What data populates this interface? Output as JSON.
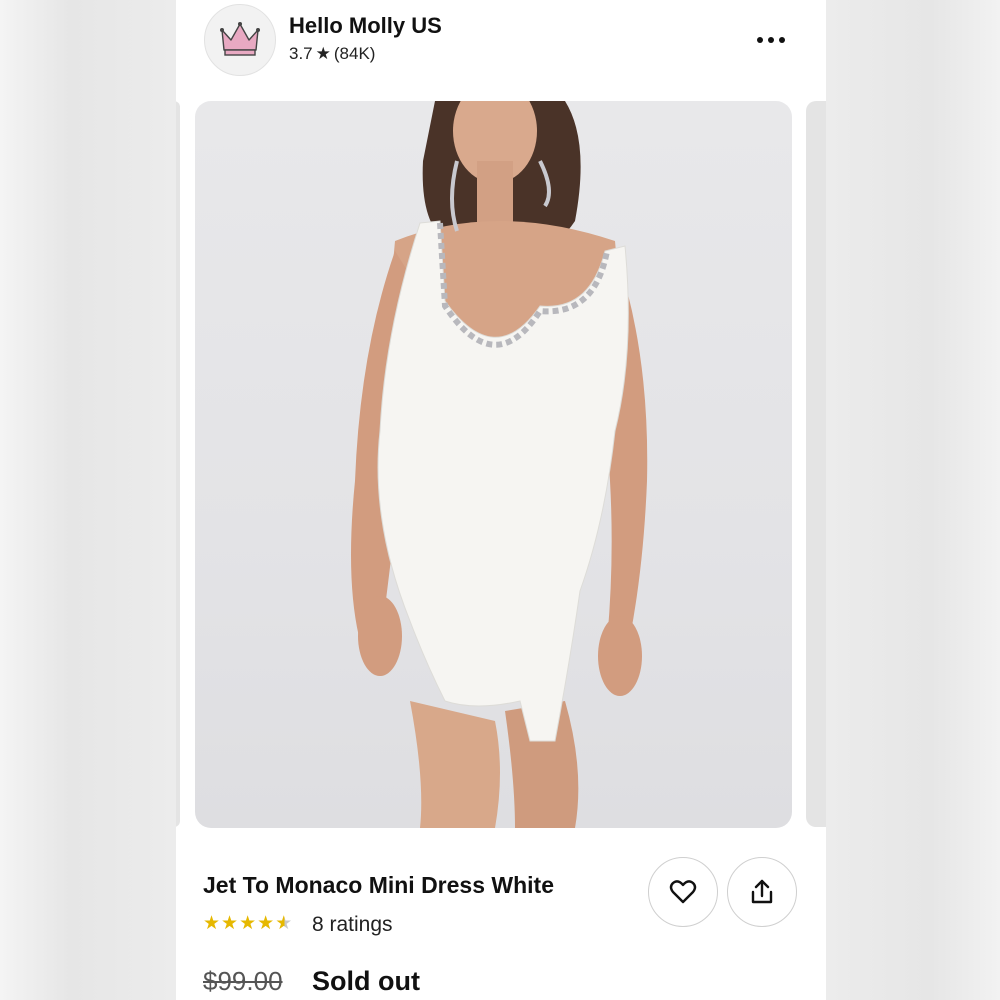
{
  "shop": {
    "name": "Hello Molly US",
    "rating": "3.7",
    "star": "★",
    "review_count": "(84K)",
    "avatar_icon": "crown-icon"
  },
  "menu": {
    "icon": "more-dots-icon"
  },
  "product": {
    "image_subject": "white mini dress with embellished neckline",
    "title": "Jet To Monaco Mini Dress White",
    "rating_value": 4.5,
    "ratings_label": "8 ratings",
    "original_price": "$99.00",
    "status": "Sold out"
  },
  "actions": {
    "favorite_icon": "heart-icon",
    "share_icon": "share-icon"
  },
  "colors": {
    "star": "#e6b800",
    "crown": "#e8a9c2",
    "text": "#111111"
  }
}
